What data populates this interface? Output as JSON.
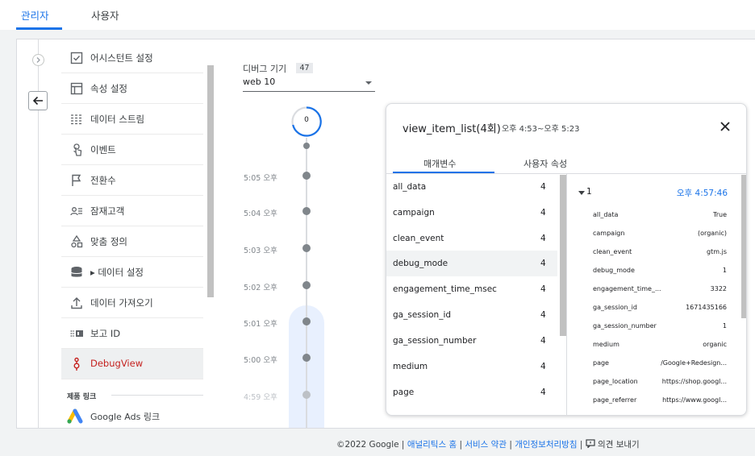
{
  "top_tabs": [
    {
      "label": "관리자",
      "active": true
    },
    {
      "label": "사용자",
      "active": false
    }
  ],
  "nav": {
    "items": [
      {
        "label": "어시스턴트 설정",
        "icon": "checkbox-icon"
      },
      {
        "label": "속성 설정",
        "icon": "window-icon"
      },
      {
        "label": "데이터 스트림",
        "icon": "streams-icon"
      },
      {
        "label": "이벤트",
        "icon": "touch-icon"
      },
      {
        "label": "전환수",
        "icon": "flag-icon"
      },
      {
        "label": "잠재고객",
        "icon": "audience-icon"
      },
      {
        "label": "맞춤 정의",
        "icon": "shapes-icon"
      },
      {
        "label": "▸ 데이터 설정",
        "icon": "database-icon"
      },
      {
        "label": "데이터 가져오기",
        "icon": "upload-icon"
      },
      {
        "label": "보고 ID",
        "icon": "report-id-icon"
      },
      {
        "label": "DebugView",
        "icon": "debug-icon",
        "active": true
      }
    ],
    "section_label": "제품 링크",
    "ads_label": "Google Ads 링크"
  },
  "device": {
    "label": "디버그 기기",
    "count": "47",
    "value": "web 10"
  },
  "timeline": {
    "counter": "0",
    "entries": [
      {
        "time": "5:05 오후"
      },
      {
        "time": "5:04 오후"
      },
      {
        "time": "5:03 오후"
      },
      {
        "time": "5:02 오후"
      },
      {
        "time": "5:01 오후"
      },
      {
        "time": "5:00 오후"
      },
      {
        "time": "4:59 오후"
      }
    ]
  },
  "event": {
    "title": "view_item_list(4회)",
    "time_range": "오후 4:53~오후 5:23",
    "tabs": [
      "매개변수",
      "사용자 속성"
    ],
    "parameters": [
      {
        "name": "all_data",
        "count": "4"
      },
      {
        "name": "campaign",
        "count": "4"
      },
      {
        "name": "clean_event",
        "count": "4"
      },
      {
        "name": "debug_mode",
        "count": "4"
      },
      {
        "name": "engagement_time_msec",
        "count": "4"
      },
      {
        "name": "ga_session_id",
        "count": "4"
      },
      {
        "name": "ga_session_number",
        "count": "4"
      },
      {
        "name": "medium",
        "count": "4"
      },
      {
        "name": "page",
        "count": "4"
      }
    ],
    "detail": {
      "index": "1",
      "time": "오후 4:57:46",
      "rows": [
        {
          "key": "all_data",
          "value": "True"
        },
        {
          "key": "campaign",
          "value": "(organic)"
        },
        {
          "key": "clean_event",
          "value": "gtm.js"
        },
        {
          "key": "debug_mode",
          "value": "1"
        },
        {
          "key": "engagement_time_...",
          "value": "3322"
        },
        {
          "key": "ga_session_id",
          "value": "1671435166"
        },
        {
          "key": "ga_session_number",
          "value": "1"
        },
        {
          "key": "medium",
          "value": "organic"
        },
        {
          "key": "page",
          "value": "/Google+Redesign..."
        },
        {
          "key": "page_location",
          "value": "https://shop.googl..."
        },
        {
          "key": "page_referrer",
          "value": "https://www.googl..."
        }
      ]
    }
  },
  "footer": {
    "copyright": "©2022 Google",
    "links": [
      "애널리틱스 홈",
      "서비스 약관",
      "개인정보처리방침"
    ],
    "feedback": "의견 보내기"
  },
  "colors": {
    "accent": "#1a73e8",
    "active_nav": "#c5221f"
  }
}
